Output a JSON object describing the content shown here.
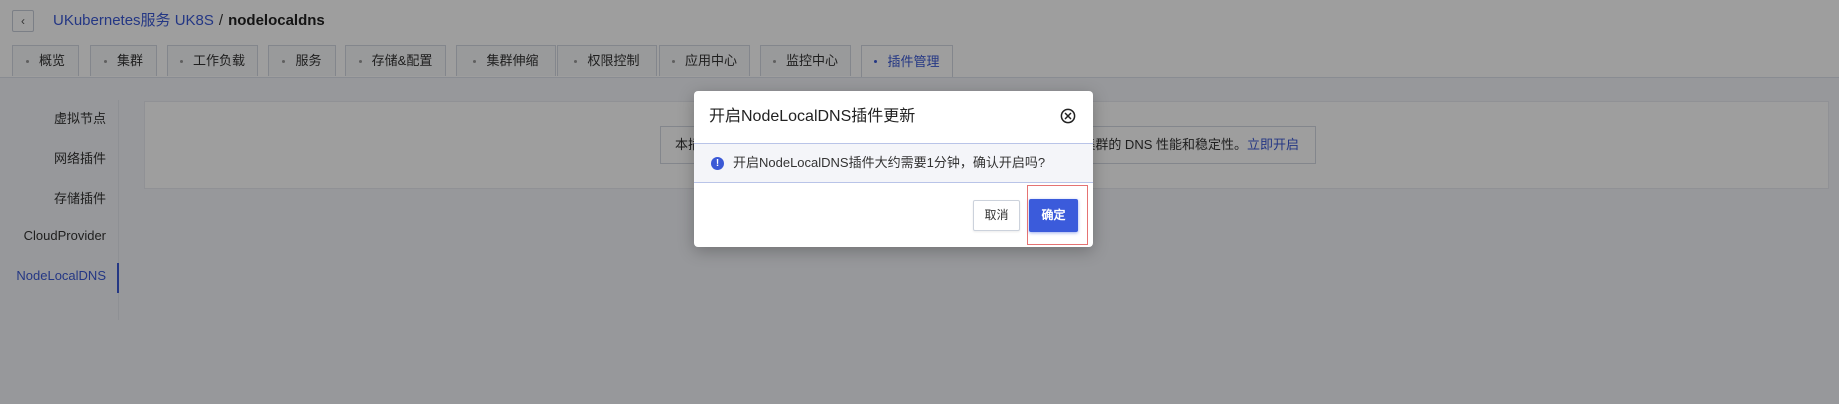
{
  "header": {
    "back_icon": "chevron-left-icon",
    "breadcrumb": {
      "link": "UKubernetes服务 UK8S",
      "separator": "/",
      "current": "nodelocaldns"
    }
  },
  "tabs": [
    {
      "label": "概览",
      "active": false
    },
    {
      "label": "集群",
      "active": false
    },
    {
      "label": "工作负载",
      "active": false
    },
    {
      "label": "服务",
      "active": false
    },
    {
      "label": "存储&配置",
      "active": false
    },
    {
      "label": "集群伸缩",
      "active": false
    },
    {
      "label": "权限控制",
      "active": false
    },
    {
      "label": "应用中心",
      "active": false
    },
    {
      "label": "监控中心",
      "active": false
    },
    {
      "label": "插件管理",
      "active": true
    }
  ],
  "sidebar": {
    "items": [
      {
        "label": "虚拟节点",
        "active": false
      },
      {
        "label": "网络插件",
        "active": false
      },
      {
        "label": "存储插件",
        "active": false
      },
      {
        "label": "CloudProvider",
        "active": false
      },
      {
        "label": "NodeLocalDNS",
        "active": true
      }
    ]
  },
  "notice": {
    "text_left": "本插",
    "text_right": "十集群的 DNS 性能和稳定性。",
    "link": "立即开启"
  },
  "modal": {
    "title": "开启NodeLocalDNS插件更新",
    "close_icon": "close-circle-icon",
    "message_icon": "info-icon",
    "message": "开启NodeLocalDNS插件大约需要1分钟，确认开启吗?",
    "cancel_label": "取消",
    "confirm_label": "确定"
  },
  "colors": {
    "accent": "#3b59d6",
    "highlight_border": "#e57373",
    "overlay": "rgba(0,0,0,0.38)"
  }
}
